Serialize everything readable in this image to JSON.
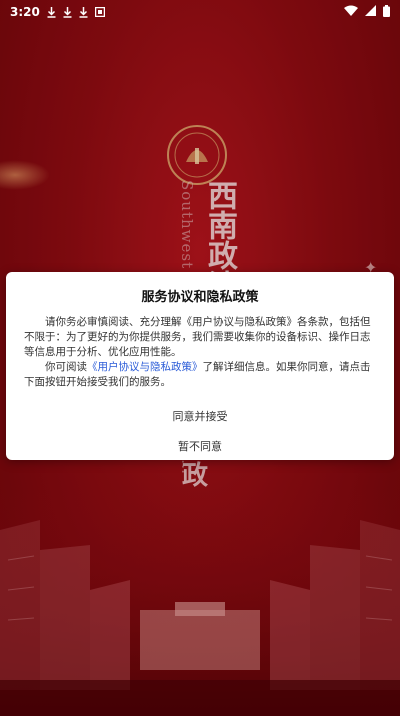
{
  "status_bar": {
    "time": "3:20",
    "icons": [
      "download-icon",
      "download-icon",
      "download-icon",
      "square-notification-icon",
      "wifi-icon",
      "signal-icon",
      "battery-icon"
    ]
  },
  "background": {
    "vertical_english": "Southwest Univ… Political Scien…",
    "calligraphy": "西南政法",
    "calligraphy_bottom": "政",
    "colors": {
      "primary_red": "#8f0c12",
      "accent_gold": "#e9c27a"
    }
  },
  "dialog": {
    "title": "服务协议和隐私政策",
    "paragraph1": "请你务必审慎阅读、充分理解《用户协议与隐私政策》各条款，包括但不限于：为了更好的为你提供服务，我们需要收集你的设备标识、操作日志等信息用于分析、优化应用性能。",
    "paragraph2_prefix": "你可阅读",
    "paragraph2_link": "《用户协议与隐私政策》",
    "paragraph2_suffix": "了解详细信息。如果你同意，请点击下面按钮开始接受我们的服务。",
    "agree_label": "同意并接受",
    "disagree_label": "暂不同意"
  }
}
